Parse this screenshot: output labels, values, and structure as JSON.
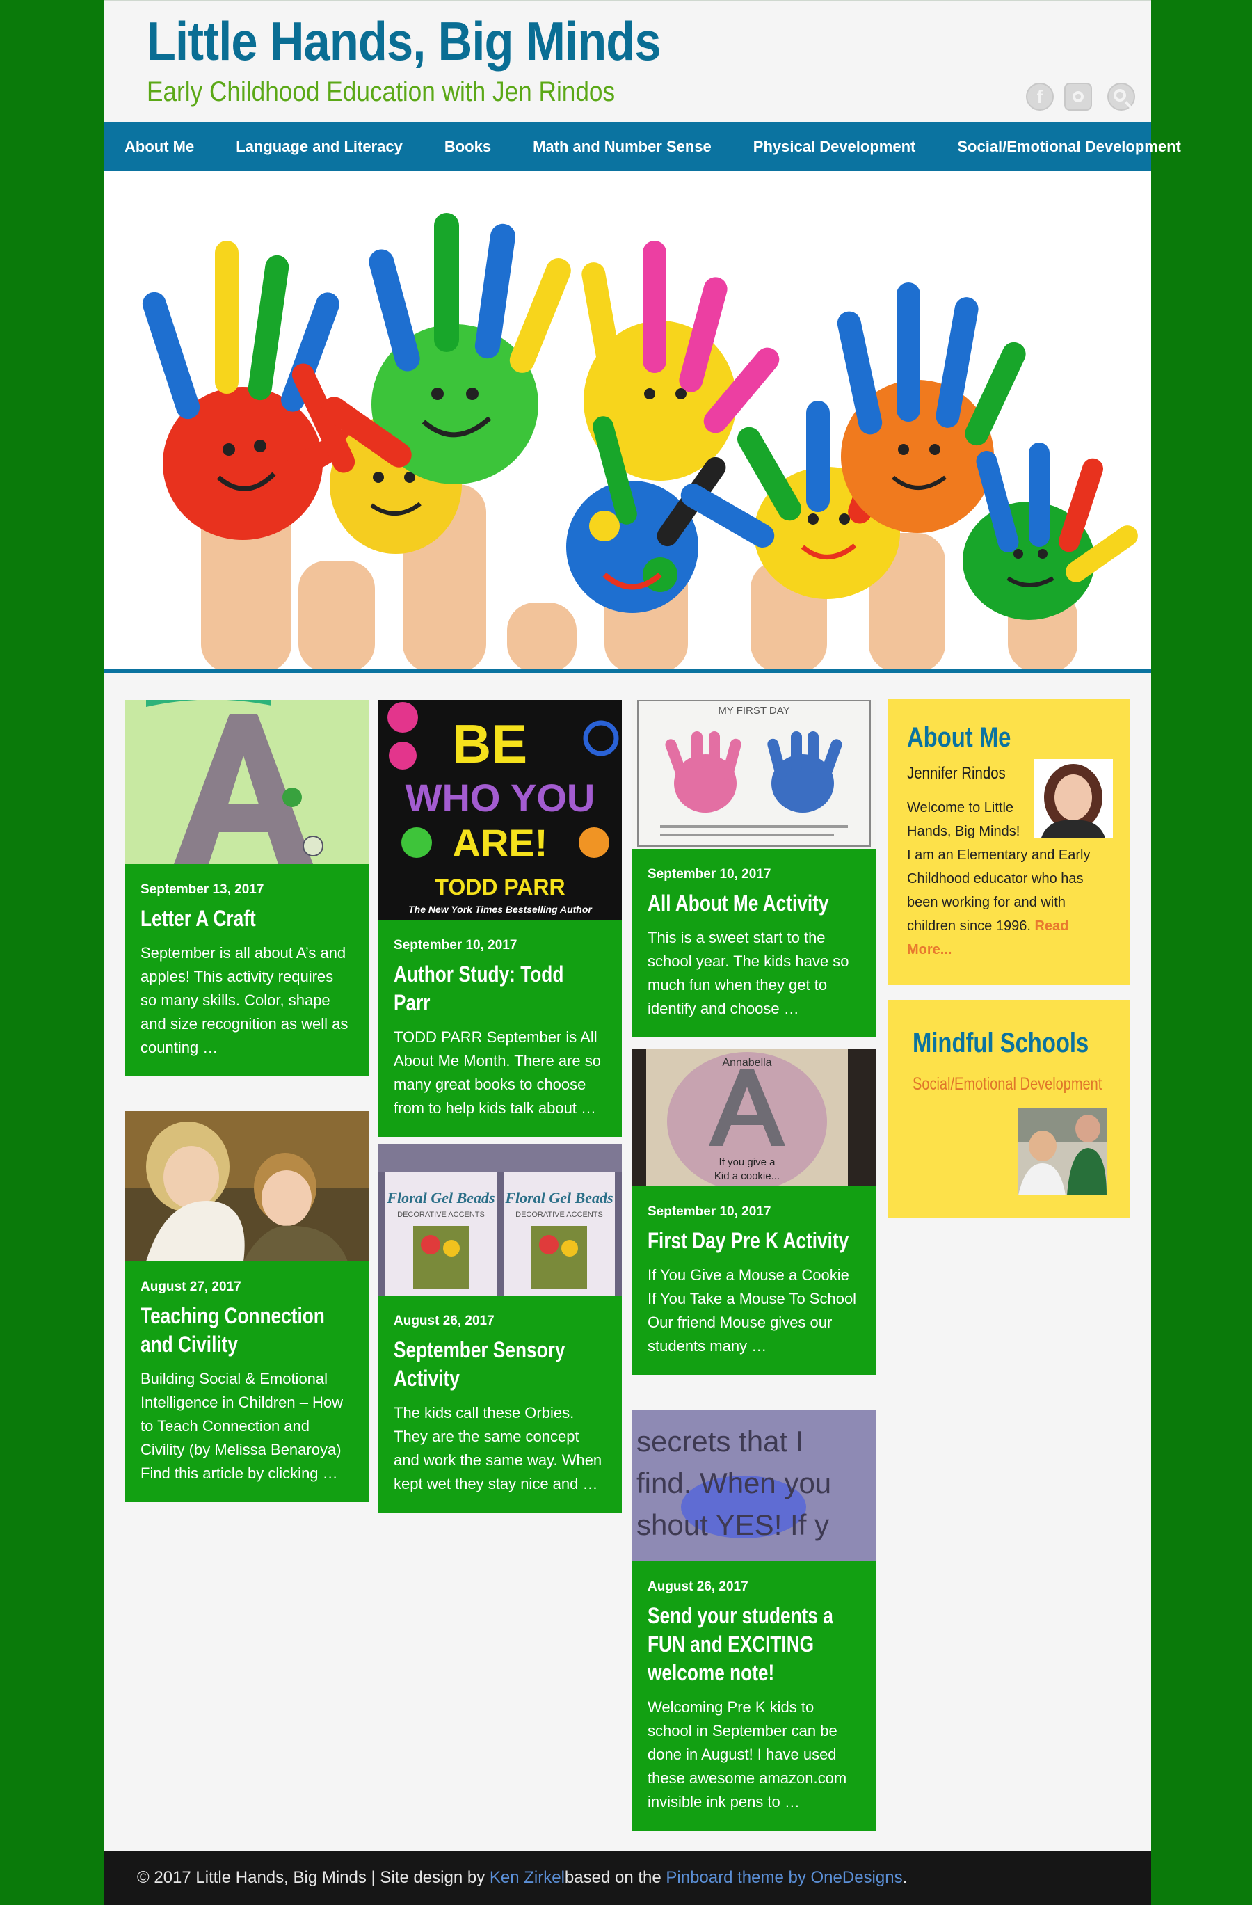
{
  "header": {
    "site_title": "Little Hands, Big Minds",
    "tagline": "Early Childhood Education with Jen Rindos",
    "social_icons": [
      "facebook-icon",
      "instagram-icon",
      "search-icon"
    ],
    "facebook_glyph": "f"
  },
  "nav": {
    "items": [
      {
        "label": "About Me"
      },
      {
        "label": "Language and Literacy"
      },
      {
        "label": "Books"
      },
      {
        "label": "Math and Number Sense"
      },
      {
        "label": "Physical Development"
      },
      {
        "label": "Social/Emotional Development"
      }
    ]
  },
  "posts": [
    {
      "date": "September 13, 2017",
      "title": "Letter A Craft",
      "excerpt": "September is all about A’s and apples! This activity requires so many skills. Color, shape and size recognition as well as counting …"
    },
    {
      "date": "August 27, 2017",
      "title": "Teaching Connection and Civility",
      "excerpt": "Building Social & Emotional Intelligence in Children – How to Teach Connection and Civility (by Melissa Benaroya) Find this article by clicking …"
    },
    {
      "date": "September 10, 2017",
      "title": "Author Study: Todd Parr",
      "excerpt": "TODD PARR September is All About Me Month. There are so many great books to choose from to help kids talk about …",
      "image_text": [
        "BE",
        "WHO YOU",
        "ARE!",
        "TODD PARR",
        "The New York Times Bestselling Author"
      ]
    },
    {
      "date": "August 26, 2017",
      "title": "September Sensory Activity",
      "excerpt": "The kids call these Orbies. They are the same concept and work the same way. When kept wet they stay nice and …",
      "image_text": [
        "Floral Gel Beads",
        "DECORATIVE ACCENTS"
      ]
    },
    {
      "date": "September 10, 2017",
      "title": "All About Me Activity",
      "excerpt": "This is a sweet start to the school year. The kids have so much fun when they get to identify and choose …",
      "image_text": [
        "MY FIRST DAY"
      ]
    },
    {
      "date": "September 10, 2017",
      "title": "First Day Pre K Activity",
      "excerpt": "If You Give a Mouse a Cookie                    If You Take a Mouse To School   Our friend Mouse gives our students many …",
      "image_text": [
        "Annabella",
        "If you give a",
        "Kid a cookie..."
      ]
    },
    {
      "date": "August 26, 2017",
      "title": "Send your students a FUN and EXCITING welcome note!",
      "excerpt": "Welcoming Pre K kids to school in September can be done in August! I have used these awesome amazon.com invisible ink pens to …",
      "image_text": [
        "secrets that I",
        "find. When you",
        "shout YES! If y"
      ]
    }
  ],
  "sidebar": {
    "about": {
      "title": "About Me",
      "name": "Jennifer Rindos",
      "text_line1": "Welcome to Little Hands, Big Minds!",
      "text_rest": "I am an Elementary and Early Childhood educator who has been working for and with children since 1996.",
      "read_more": "Read More..."
    },
    "mindful": {
      "title": "Mindful Schools",
      "subtitle": "Social/Emotional Development"
    }
  },
  "footer": {
    "prefix": "© 2017 Little Hands, Big Minds | Site design by ",
    "designer": "Ken Zirkel",
    "middle": " based on the ",
    "theme": "Pinboard theme by OneDesigns",
    "suffix": "."
  },
  "colors": {
    "body_bg": "#0a7a0a",
    "title_blue": "#0a6e94",
    "tagline_green": "#5ba817",
    "nav_blue": "#0b73a0",
    "card_green": "#12a012",
    "widget_yellow": "#fde14a",
    "accent_orange": "#e8792e"
  }
}
